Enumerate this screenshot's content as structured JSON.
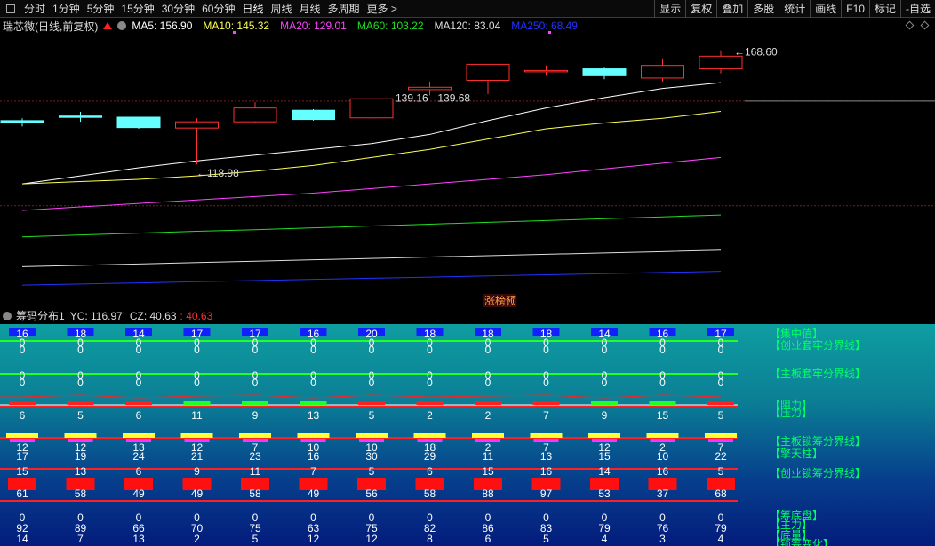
{
  "toolbar": {
    "tabs": [
      "分时",
      "1分钟",
      "5分钟",
      "15分钟",
      "30分钟",
      "60分钟",
      "日线",
      "周线",
      "月线",
      "多周期",
      "更多 >"
    ],
    "active_tab": "日线",
    "right_buttons": [
      "显示",
      "复权",
      "叠加",
      "多股",
      "统计",
      "画线",
      "F10",
      "标记",
      "-自选"
    ]
  },
  "kline": {
    "title": "瑞芯微(日线,前复权)",
    "ma": [
      {
        "label": "MA5: 156.90",
        "color": "#ffffff"
      },
      {
        "label": "MA10: 145.32",
        "color": "#ffff55"
      },
      {
        "label": "MA20: 129.01",
        "color": "#ff44ff"
      },
      {
        "label": "MA60: 103.22",
        "color": "#22dd22"
      },
      {
        "label": "MA120: 83.04",
        "color": "#dddddd"
      },
      {
        "label": "MA250: 68.49",
        "color": "#2233ff"
      }
    ],
    "annotations": {
      "high": "168.60",
      "low": "118.98",
      "range": "139.16 - 139.68",
      "tag": "涨榜预"
    },
    "colors": {
      "up": "#ff3030",
      "down": "#66ffff",
      "bg": "#000000"
    },
    "candles": [
      {
        "o": 138.0,
        "c": 137.0,
        "h": 139.0,
        "l": 135.5
      },
      {
        "o": 140.0,
        "c": 139.5,
        "h": 141.8,
        "l": 137.5
      },
      {
        "o": 139.5,
        "c": 135.0,
        "h": 139.5,
        "l": 134.5
      },
      {
        "o": 134.8,
        "c": 137.5,
        "h": 139.0,
        "l": 118.98
      },
      {
        "o": 137.5,
        "c": 143.5,
        "h": 146.0,
        "l": 137.0
      },
      {
        "o": 142.5,
        "c": 138.5,
        "h": 143.0,
        "l": 138.0
      },
      {
        "o": 139.2,
        "c": 147.5,
        "h": 147.5,
        "l": 139.0
      },
      {
        "o": 151.5,
        "c": 152.5,
        "h": 155.0,
        "l": 149.0
      },
      {
        "o": 155.5,
        "c": 162.5,
        "h": 162.5,
        "l": 149.5
      },
      {
        "o": 159.5,
        "c": 159.8,
        "h": 162.0,
        "l": 157.5
      },
      {
        "o": 160.5,
        "c": 157.5,
        "h": 161.0,
        "l": 156.0
      },
      {
        "o": 156.5,
        "c": 162.0,
        "h": 165.0,
        "l": 155.0
      },
      {
        "o": 160.5,
        "c": 166.0,
        "h": 168.6,
        "l": 158.5
      }
    ],
    "ma_lines": [
      {
        "name": "MA5",
        "color": "#ffffff",
        "values": [
          110.5,
          114.0,
          117.5,
          120.5,
          123.0,
          125.5,
          128.0,
          132.0,
          138.0,
          143.5,
          148.0,
          152.0,
          154.5
        ]
      },
      {
        "name": "MA10",
        "color": "#ffff55",
        "values": [
          110.5,
          111.5,
          112.5,
          114.0,
          116.0,
          118.5,
          122.0,
          125.5,
          130.0,
          134.5,
          137.0,
          139.0,
          142.0
        ]
      },
      {
        "name": "MA20",
        "color": "#ff44ff",
        "values": [
          99.0,
          100.5,
          102.0,
          103.5,
          105.0,
          106.5,
          108.5,
          110.5,
          112.5,
          114.5,
          117.0,
          119.5,
          122.0
        ]
      },
      {
        "name": "MA60",
        "color": "#22dd22",
        "values": [
          87.5,
          88.3,
          89.1,
          89.9,
          90.6,
          91.4,
          92.2,
          93.0,
          93.8,
          94.6,
          95.4,
          96.2,
          97.0
        ]
      },
      {
        "name": "MA120",
        "color": "#dddddd",
        "values": [
          74.5,
          75.1,
          75.7,
          76.3,
          76.9,
          77.5,
          78.1,
          78.7,
          79.3,
          79.9,
          80.5,
          81.1,
          81.7
        ]
      },
      {
        "name": "MA250",
        "color": "#2233ff",
        "values": [
          66.5,
          67.0,
          67.5,
          68.0,
          68.5,
          69.0,
          69.5,
          70.0,
          70.5,
          71.0,
          71.5,
          72.0,
          72.5
        ]
      }
    ],
    "hlines": [
      146.5,
      101.0
    ]
  },
  "chip": {
    "title": "筹码分布1",
    "yc": "YC: 116.97",
    "cz": "CZ: 40.63",
    "cz2": ": 40.63",
    "labels": [
      "【集中值】",
      "【创业套牢分界线】",
      "【主板套牢分界线】",
      "【阻力】",
      "【压力】",
      "【主板锁筹分界线】",
      "【擎天柱】",
      "【创业锁筹分界线】",
      "【筹底盘】",
      "【主力】",
      "【底量】",
      "【锁筹变化】"
    ],
    "row1": [
      "16",
      "18",
      "14",
      "17",
      "17",
      "16",
      "20",
      "18",
      "18",
      "18",
      "14",
      "16",
      "17"
    ],
    "row_zero": [
      "0",
      "0",
      "0",
      "0",
      "0",
      "0",
      "0",
      "0",
      "0",
      "0",
      "0",
      "0",
      "0"
    ],
    "row_mid": [
      "6",
      "5",
      "6",
      "11",
      "9",
      "13",
      "5",
      "2",
      "2",
      "7",
      "9",
      "15",
      "5"
    ],
    "row_a1": [
      "12",
      "12",
      "13",
      "12",
      "7",
      "10",
      "10",
      "18",
      "2",
      "7",
      "12",
      "2",
      "7"
    ],
    "row_a2": [
      "17",
      "19",
      "24",
      "21",
      "23",
      "16",
      "30",
      "29",
      "11",
      "13",
      "15",
      "10",
      "22"
    ],
    "row_b1": [
      "15",
      "13",
      "6",
      "9",
      "11",
      "7",
      "5",
      "6",
      "15",
      "16",
      "14",
      "16",
      "5"
    ],
    "row_b2": [
      "61",
      "58",
      "49",
      "49",
      "58",
      "49",
      "56",
      "58",
      "88",
      "97",
      "53",
      "37",
      "68"
    ],
    "row_c1": [
      "0",
      "0",
      "0",
      "0",
      "0",
      "0",
      "0",
      "0",
      "0",
      "0",
      "0",
      "0",
      "0"
    ],
    "row_c2": [
      "92",
      "89",
      "66",
      "70",
      "75",
      "63",
      "75",
      "82",
      "86",
      "83",
      "79",
      "76",
      "79"
    ],
    "row_c3": [
      "14",
      "7",
      "13",
      "2",
      "5",
      "12",
      "12",
      "8",
      "6",
      "5",
      "4",
      "3",
      "4"
    ]
  }
}
